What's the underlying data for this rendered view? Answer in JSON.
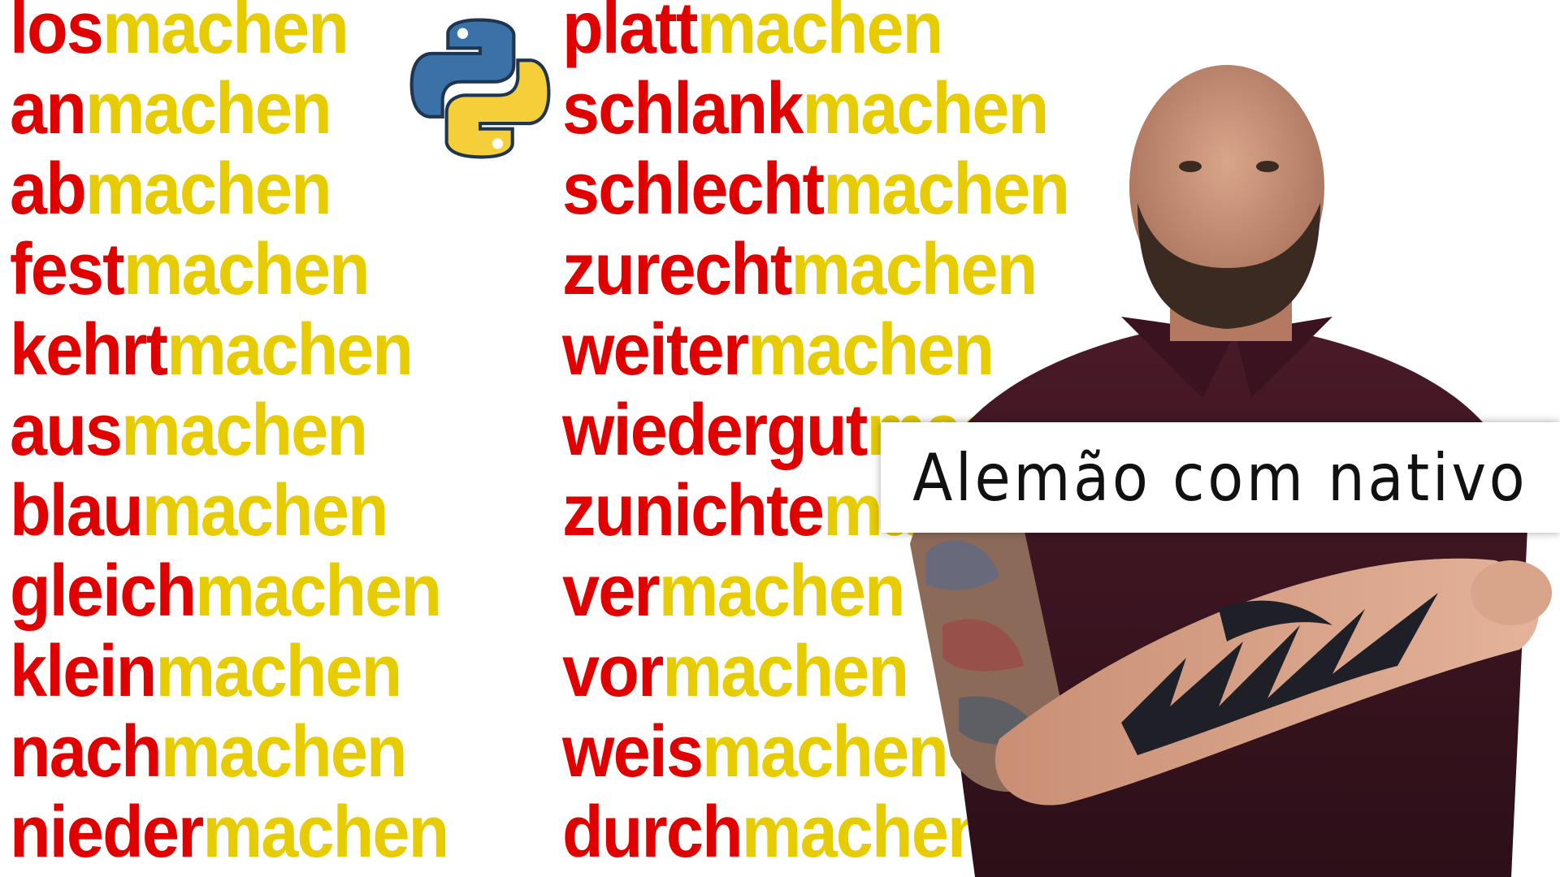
{
  "left_words": [
    {
      "prefix": "los",
      "suffix": "machen"
    },
    {
      "prefix": "an",
      "suffix": "machen"
    },
    {
      "prefix": "ab",
      "suffix": "machen"
    },
    {
      "prefix": "fest",
      "suffix": "machen"
    },
    {
      "prefix": "kehrt",
      "suffix": "machen"
    },
    {
      "prefix": "aus",
      "suffix": "machen"
    },
    {
      "prefix": "blau",
      "suffix": "machen"
    },
    {
      "prefix": "gleich",
      "suffix": "machen"
    },
    {
      "prefix": "klein",
      "suffix": "machen"
    },
    {
      "prefix": "nach",
      "suffix": "machen"
    },
    {
      "prefix": "nieder",
      "suffix": "machen"
    }
  ],
  "right_words": [
    {
      "prefix": "platt",
      "suffix": "machen"
    },
    {
      "prefix": "schlank",
      "suffix": "machen"
    },
    {
      "prefix": "schlecht",
      "suffix": "machen"
    },
    {
      "prefix": "zurecht",
      "suffix": "machen"
    },
    {
      "prefix": "weiter",
      "suffix": "machen"
    },
    {
      "prefix": "wiedergut",
      "suffix": "machen"
    },
    {
      "prefix": "zunichte",
      "suffix": "machen"
    },
    {
      "prefix": "ver",
      "suffix": "machen"
    },
    {
      "prefix": "vor",
      "suffix": "machen"
    },
    {
      "prefix": "weis",
      "suffix": "machen"
    },
    {
      "prefix": "durch",
      "suffix": "machen"
    }
  ],
  "caption": "Alemão com nativo",
  "icons": {
    "logo": "python-logo-icon",
    "person": "presenter-photo"
  },
  "colors": {
    "prefix": "#e00000",
    "suffix": "#e6cc00",
    "python_blue": "#3a72a8",
    "python_yellow": "#f5cf3a",
    "shirt": "#3a1420"
  }
}
